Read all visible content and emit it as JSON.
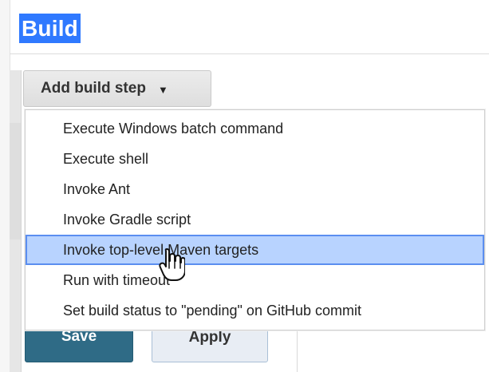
{
  "build": {
    "section_title": "Build",
    "add_step_label": "Add build step",
    "caret_icon": "caret-down-icon"
  },
  "menu": {
    "items": [
      "Execute Windows batch command",
      "Execute shell",
      "Invoke Ant",
      "Invoke Gradle script",
      "Invoke top-level Maven targets",
      "Run with timeout",
      "Set build status to \"pending\" on GitHub commit"
    ],
    "highlighted_index": 4
  },
  "actions": {
    "save_label": "Save",
    "apply_label": "Apply"
  },
  "cursor": {
    "icon": "hand-pointer-icon"
  },
  "colors": {
    "title_highlight": "#2f79ff",
    "menu_highlight": "#b8d3ff",
    "menu_highlight_border": "#5b8ef0",
    "save_button": "#2f6b86",
    "apply_button": "#e8edf4"
  }
}
